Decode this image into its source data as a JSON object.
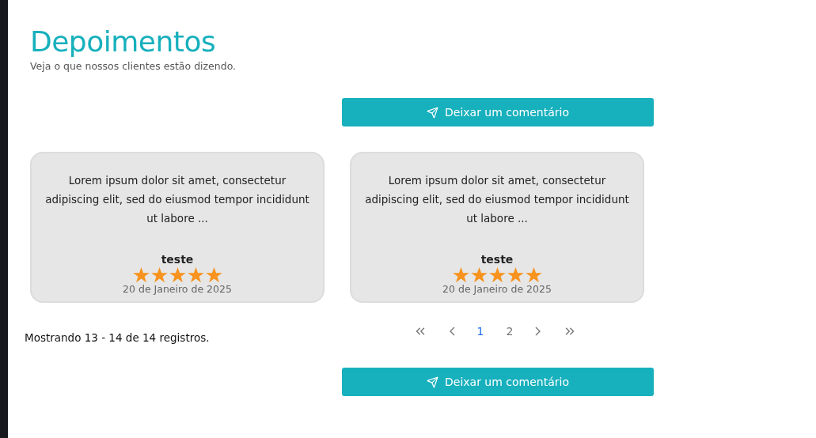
{
  "header": {
    "title": "Depoimentos",
    "subtitle": "Veja o que nossos clientes estão dizendo."
  },
  "top_button": {
    "label": "Deixar um comentário"
  },
  "testimonials": [
    {
      "text": "Lorem ipsum dolor sit amet, consectetur adipiscing elit, sed do eiusmod tempor incididunt ut labore ...",
      "author": "teste",
      "stars": 5,
      "date": "20 de Janeiro de 2025"
    },
    {
      "text": "Lorem ipsum dolor sit amet, consectetur adipiscing elit, sed do eiusmod tempor incididunt ut labore ...",
      "author": "teste",
      "stars": 5,
      "date": "20 de Janeiro de 2025"
    }
  ],
  "summary": "Mostrando 13 - 14 de 14 registros.",
  "pagination": {
    "pages": [
      {
        "label": "1",
        "selected": true
      },
      {
        "label": "2",
        "selected": false
      }
    ]
  },
  "bottom_button": {
    "label": "Deixar um comentário"
  }
}
